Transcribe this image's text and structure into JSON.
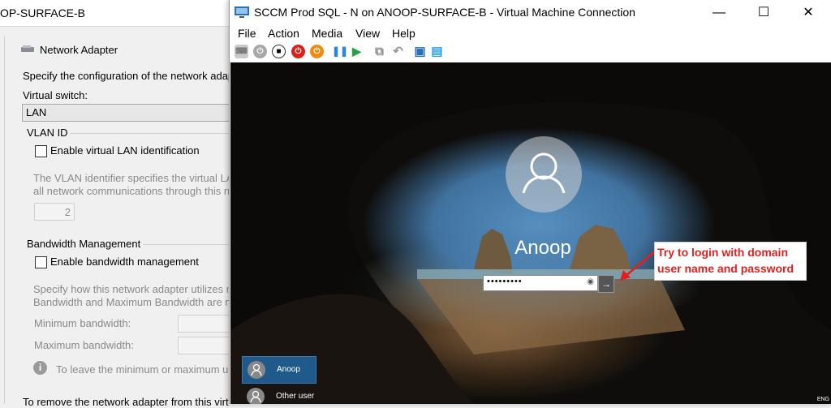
{
  "settings_window": {
    "title": "OP-SURFACE-B",
    "section_title": "Network Adapter",
    "description": "Specify the configuration of the network adap",
    "virtual_switch_label": "Virtual switch:",
    "virtual_switch_value": "LAN",
    "vlan": {
      "group_label": "VLAN ID",
      "checkbox_label": "Enable virtual LAN identification",
      "help_line1": "The VLAN identifier specifies the virtual LA",
      "help_line2": "all network communications through this ne",
      "value": "2"
    },
    "bandwidth": {
      "group_label": "Bandwidth Management",
      "checkbox_label": "Enable bandwidth management",
      "help_line1": "Specify how this network adapter utilizes n",
      "help_line2": "Bandwidth and Maximum Bandwidth are m",
      "min_label": "Minimum bandwidth:",
      "max_label": "Maximum bandwidth:",
      "info_text": "To leave the minimum or maximum u",
      "min_value": "(",
      "max_value": "("
    },
    "footer_text": "To remove the network adapter from this virt"
  },
  "vm_window": {
    "title": "SCCM Prod SQL - N on ANOOP-SURFACE-B - Virtual Machine Connection",
    "buttons": {
      "minimize": "—",
      "maximize": "☐",
      "close": "✕"
    },
    "menu": [
      "File",
      "Action",
      "Media",
      "View",
      "Help"
    ],
    "toolbar": {
      "ctrl_alt_del": "⌨",
      "start": "⏻",
      "turn_off": "■",
      "shutdown": "⏻",
      "save": "⏻",
      "pause": "❚❚",
      "resume": "▶",
      "checkpoint": "⧉",
      "revert": "↶",
      "enhanced": "▣",
      "share": "▤"
    },
    "login": {
      "user_name": "Anoop",
      "password_mask": "•••••••••",
      "eye_glyph": "◉",
      "submit_glyph": "→"
    },
    "annotation": {
      "line1": "Try to login with domain",
      "line2": "user name and password",
      "color": "#e02020"
    },
    "users": [
      {
        "label": "Anoop",
        "selected": true
      },
      {
        "label": "Other user",
        "selected": false
      }
    ],
    "language": "ENG"
  }
}
